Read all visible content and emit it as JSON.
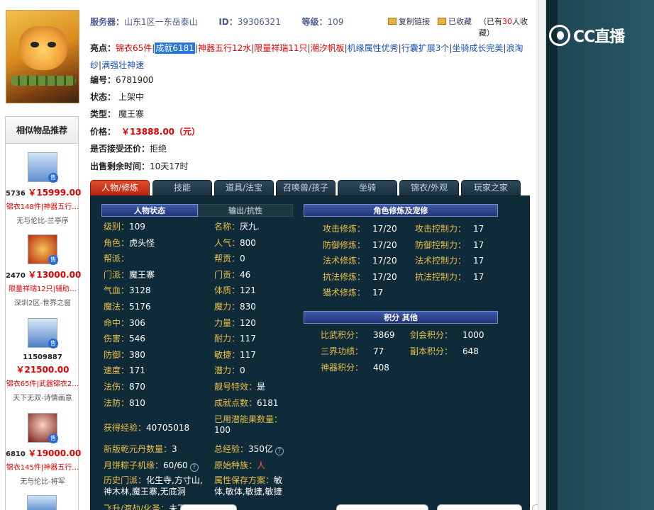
{
  "header": {
    "server_label": "服务器：",
    "server_value": "山东1区一东岳泰山",
    "id_label": "ID：",
    "id_value": "39306321",
    "level_label": "等级：",
    "level_value": "109",
    "copy_link": "复制链接",
    "favorited": "已收藏",
    "fav_prefix": "（已有",
    "fav_count": "30",
    "fav_suffix": "人收藏）"
  },
  "highlights": {
    "label": "亮点：",
    "items": [
      {
        "text": "锦衣65件",
        "style": "red"
      },
      {
        "text": "成就6181",
        "style": "sel"
      },
      {
        "text": "神器五行12水",
        "style": "red"
      },
      {
        "text": "限量祥瑞11只",
        "style": "red"
      },
      {
        "text": "潮汐帆板",
        "style": "red"
      },
      {
        "text": "机缘属性优秀",
        "style": "blue"
      },
      {
        "text": "行囊扩展3个",
        "style": "blue"
      },
      {
        "text": "坐骑成长完美",
        "style": "blue"
      },
      {
        "text": "浪淘纱",
        "style": "blue"
      },
      {
        "text": "满强壮神速",
        "style": "blue"
      }
    ]
  },
  "info": {
    "serial_label": "编号：",
    "serial_value": "6781900",
    "status_label": "状态：",
    "status_value": "上架中",
    "type_label": "类型：",
    "type_value": "魔王寨",
    "price_label": "价格：",
    "price_value": "￥13888.00（元）",
    "bargain_label": "是否接受还价：",
    "bargain_value": "拒绝",
    "remain_label": "出售剩余时间：",
    "remain_value": "10天17时"
  },
  "tabs": [
    "人物/修炼",
    "技能",
    "道具/法宝",
    "召唤兽/孩子",
    "坐骑",
    "锦衣/外观",
    "玩家之家"
  ],
  "panel": {
    "hdr_person": "人物状态",
    "hdr_output": "输出/抗性",
    "hdr_cultivation": "角色修炼及宠修",
    "hdr_points": "积分 其他",
    "left_col": [
      {
        "k": "级别：",
        "v": "109"
      },
      {
        "k": "角色：",
        "v": "虎头怪"
      },
      {
        "k": "帮派：",
        "v": ""
      },
      {
        "k": "门派：",
        "v": "魔王寨"
      },
      {
        "k": "气血：",
        "v": "3128"
      },
      {
        "k": "魔法：",
        "v": "5176"
      },
      {
        "k": "命中：",
        "v": "306"
      },
      {
        "k": "伤害：",
        "v": "546"
      },
      {
        "k": "防御：",
        "v": "380"
      },
      {
        "k": "速度：",
        "v": "171"
      },
      {
        "k": "法伤：",
        "v": "870"
      },
      {
        "k": "法防：",
        "v": "810"
      }
    ],
    "mid_col": [
      {
        "k": "名称：",
        "v": "厌九."
      },
      {
        "k": "人气：",
        "v": "800"
      },
      {
        "k": "帮贡：",
        "v": "0"
      },
      {
        "k": "门贡：",
        "v": "46"
      },
      {
        "k": "体质：",
        "v": "121"
      },
      {
        "k": "魔力：",
        "v": "830"
      },
      {
        "k": "力量：",
        "v": "120"
      },
      {
        "k": "耐力：",
        "v": "117"
      },
      {
        "k": "敏捷：",
        "v": "117"
      },
      {
        "k": "潜力：",
        "v": "0"
      },
      {
        "k": "靓号特效：",
        "v": "是"
      },
      {
        "k": "成就点数：",
        "v": "6181"
      }
    ],
    "exp_label": "获得经验：",
    "exp_value": "40705018",
    "potential_label": "已用潜能果数量：",
    "potential_value": "100",
    "qianyuan_label": "新版乾元丹数量：",
    "qianyuan_value": "3",
    "total_exp_label": "总经验：",
    "total_exp_value": "350亿",
    "zongzi_label": "月饼粽子机缘：",
    "zongzi_value": "60/60",
    "race_label": "原始种族：",
    "race_value": "人",
    "history_label": "历史门派：",
    "history_value_1": "化生寺,方寸山,",
    "history_value_2": "神木林,魔王寨,无底洞",
    "attr_save_label": "属性保存方案：",
    "attr_save_value_1": "敏",
    "attr_save_value_2": "体,敏体,敏捷,敏捷",
    "ascend_label": "飞升/渡劫/化圣：",
    "ascend_value": "未飞升",
    "cultivation": [
      {
        "k1": "攻击修炼：",
        "v1": "17/20",
        "k2": "攻击控制力：",
        "v2": "17"
      },
      {
        "k1": "防御修炼：",
        "v1": "17/20",
        "k2": "防御控制力：",
        "v2": "17"
      },
      {
        "k1": "法术修炼：",
        "v1": "17/20",
        "k2": "法术控制力：",
        "v2": "17"
      },
      {
        "k1": "抗法修炼：",
        "v1": "17/20",
        "k2": "抗法控制力：",
        "v2": "17"
      },
      {
        "k1": "猎术修炼：",
        "v1": "17",
        "k2": "",
        "v2": ""
      }
    ],
    "points": [
      {
        "k1": "比武积分：",
        "v1": "3869",
        "k2": "剑会积分：",
        "v2": "1000"
      },
      {
        "k1": "三界功绩：",
        "v1": "77",
        "k2": "副本积分：",
        "v2": "648"
      },
      {
        "k1": "神器积分：",
        "v1": "408",
        "k2": "",
        "v2": ""
      }
    ]
  },
  "similar": {
    "title": "相似物品推荐",
    "items": [
      {
        "id": "5736",
        "price": "￥15999.00",
        "tags": "锦衣148件|神器五行…",
        "server": "无与伦比-兰亭序",
        "icon": "blue-hair-avatar"
      },
      {
        "id": "2470",
        "price": "￥13000.00",
        "tags": "限量祥瑞12只|辅助…",
        "server": "深圳2区-世界之窗",
        "icon": "red-demon-avatar"
      },
      {
        "id": "11509887",
        "price": "￥21500.00",
        "tags": "锦衣65件|武器锦衣2…",
        "server": "天下无双-诗情画意",
        "icon": "blue-hair-avatar"
      },
      {
        "id": "6810",
        "price": "￥19000.00",
        "tags": "锦衣145件|神器五行…",
        "server": "无与伦比-将军",
        "icon": "girl-avatar"
      }
    ],
    "sell_badge": "售"
  },
  "brand": {
    "logo_text": "CC直播",
    "logo_icon": "cc-logo-icon"
  },
  "colors": {
    "accent_red": "#e00000",
    "link_blue": "#1b4fb0",
    "panel_bg": "#0f2a38",
    "label_gold": "#e8c04a",
    "active_tab": "#d0381c"
  }
}
